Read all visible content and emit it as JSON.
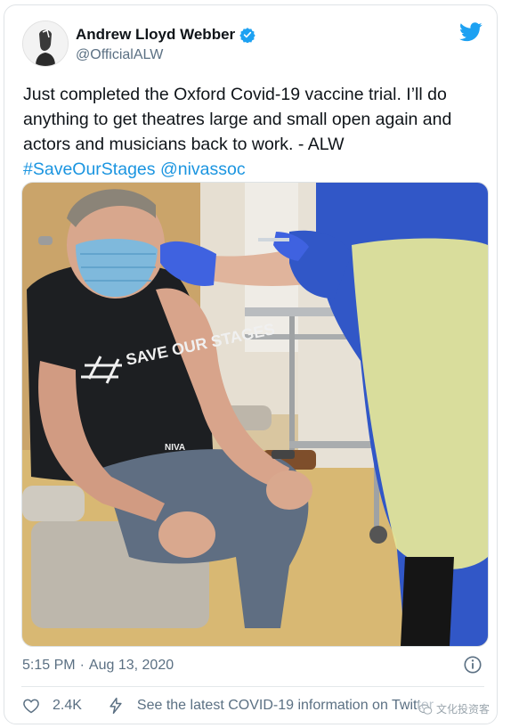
{
  "tweet": {
    "author": {
      "name": "Andrew Lloyd Webber",
      "handle": "@OfficialALW",
      "verified": true,
      "avatar_icon": "portrait-avatar-icon"
    },
    "platform_icon": "twitter-bird-icon",
    "text": "Just completed the Oxford Covid-19 vaccine trial. I’ll do anything to get theatres large and small open again and actors and musicians back to work. - ALW",
    "hashtag": "#SaveOurStages",
    "mention": "@nivassoc",
    "media": {
      "shirt_text": "SAVE OUR STAGES",
      "shirt_logo": "NIVA"
    },
    "time": "5:15 PM",
    "separator": "·",
    "date": "Aug 13, 2020",
    "like_count": "2.4K",
    "covid_info": "See the latest COVID-19 information on Twitter"
  },
  "watermark": {
    "text": "文化投资客"
  },
  "colors": {
    "link": "#1b95e0",
    "verified_badge": "#1da1f2",
    "secondary_text": "#5b7083"
  }
}
